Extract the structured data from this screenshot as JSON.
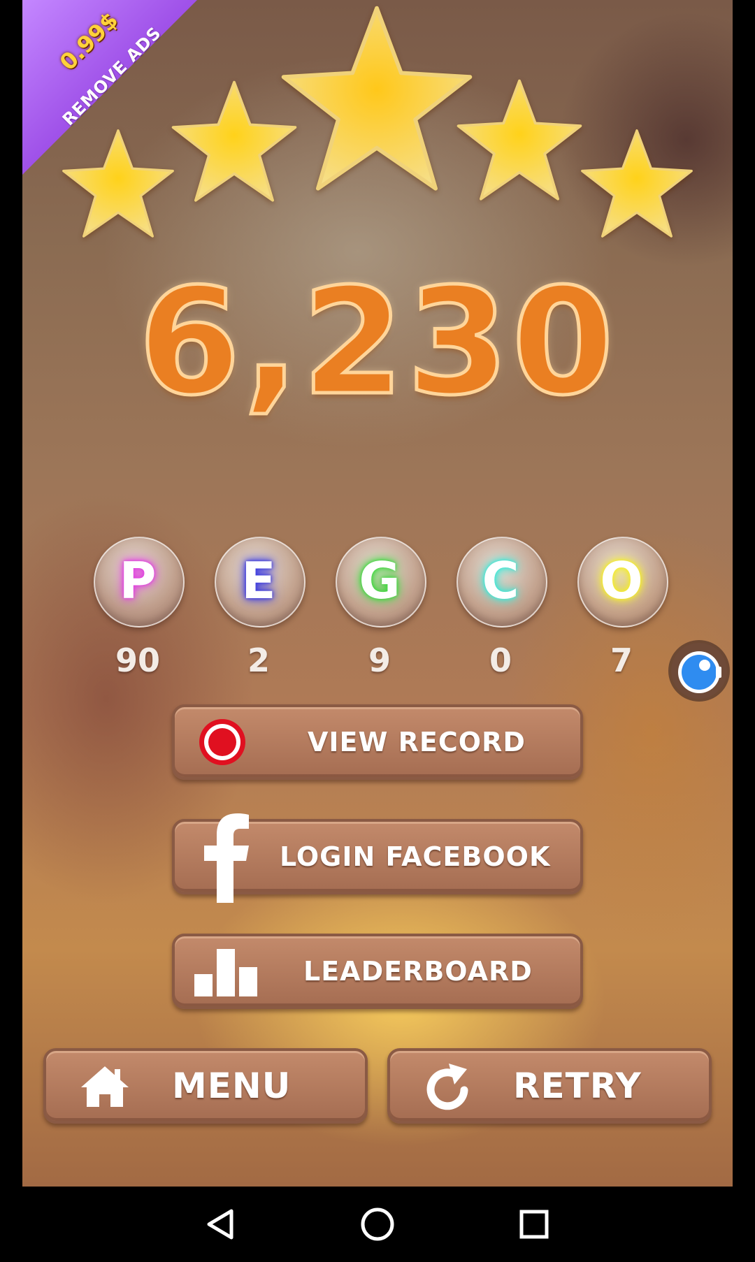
{
  "promo": {
    "price": "0.99$",
    "label": "REMOVE ADS"
  },
  "rating": {
    "stars": 5,
    "max": 5
  },
  "score": "6,230",
  "letters": [
    {
      "letter": "P",
      "count": "90",
      "color": "#e040e0"
    },
    {
      "letter": "E",
      "count": "2",
      "color": "#3a3ae0"
    },
    {
      "letter": "G",
      "count": "9",
      "color": "#3ed83e"
    },
    {
      "letter": "C",
      "count": "0",
      "color": "#3ee8d8"
    },
    {
      "letter": "O",
      "count": "7",
      "color": "#f4ee2a"
    }
  ],
  "buttons": {
    "view_record": "VIEW RECORD",
    "login_facebook": "LOGIN FACEBOOK",
    "leaderboard": "LEADERBOARD",
    "menu": "MENU",
    "retry": "RETRY"
  },
  "icons": {
    "record": "record-icon",
    "facebook": "facebook-icon",
    "leaderboard": "bar-chart-icon",
    "menu": "home-icon",
    "retry": "refresh-icon",
    "screen_record": "video-camera-icon"
  },
  "colors": {
    "score": "#ea7f22",
    "record_red": "#e01020",
    "star": "#ffc81a",
    "promo": "#9b4be6"
  },
  "navbar": {
    "back": "back-icon",
    "home": "home-circle-icon",
    "recents": "recents-icon"
  }
}
